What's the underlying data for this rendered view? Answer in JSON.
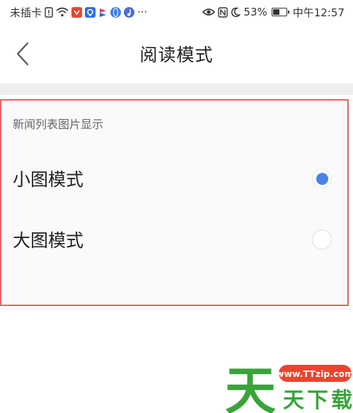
{
  "status_bar": {
    "carrier": "未插卡",
    "battery_percent": "53%",
    "time": "中午12:57",
    "more": "···",
    "battery_level": 0.53,
    "icons": [
      "sim-alert-icon",
      "wifi-icon",
      "app-red-icon",
      "app-blue-icon",
      "app-flag-icon",
      "app-globe-icon",
      "app-music-icon",
      "eye-icon",
      "nfc-icon",
      "moon-icon",
      "battery-icon"
    ]
  },
  "header": {
    "title": "阅读模式",
    "back_icon": "chevron-left-icon"
  },
  "section": {
    "label": "新闻列表图片显示",
    "options": [
      {
        "label": "小图模式",
        "selected": true
      },
      {
        "label": "大图模式",
        "selected": false
      }
    ]
  },
  "watermark": {
    "url": "www.TTzip.com",
    "brand": "天下载",
    "logo_char": "天"
  },
  "colors": {
    "accent": "#4b82ea",
    "highlight_border": "#e06666",
    "watermark_green": "#3aa33a",
    "watermark_red": "#e8452f"
  }
}
